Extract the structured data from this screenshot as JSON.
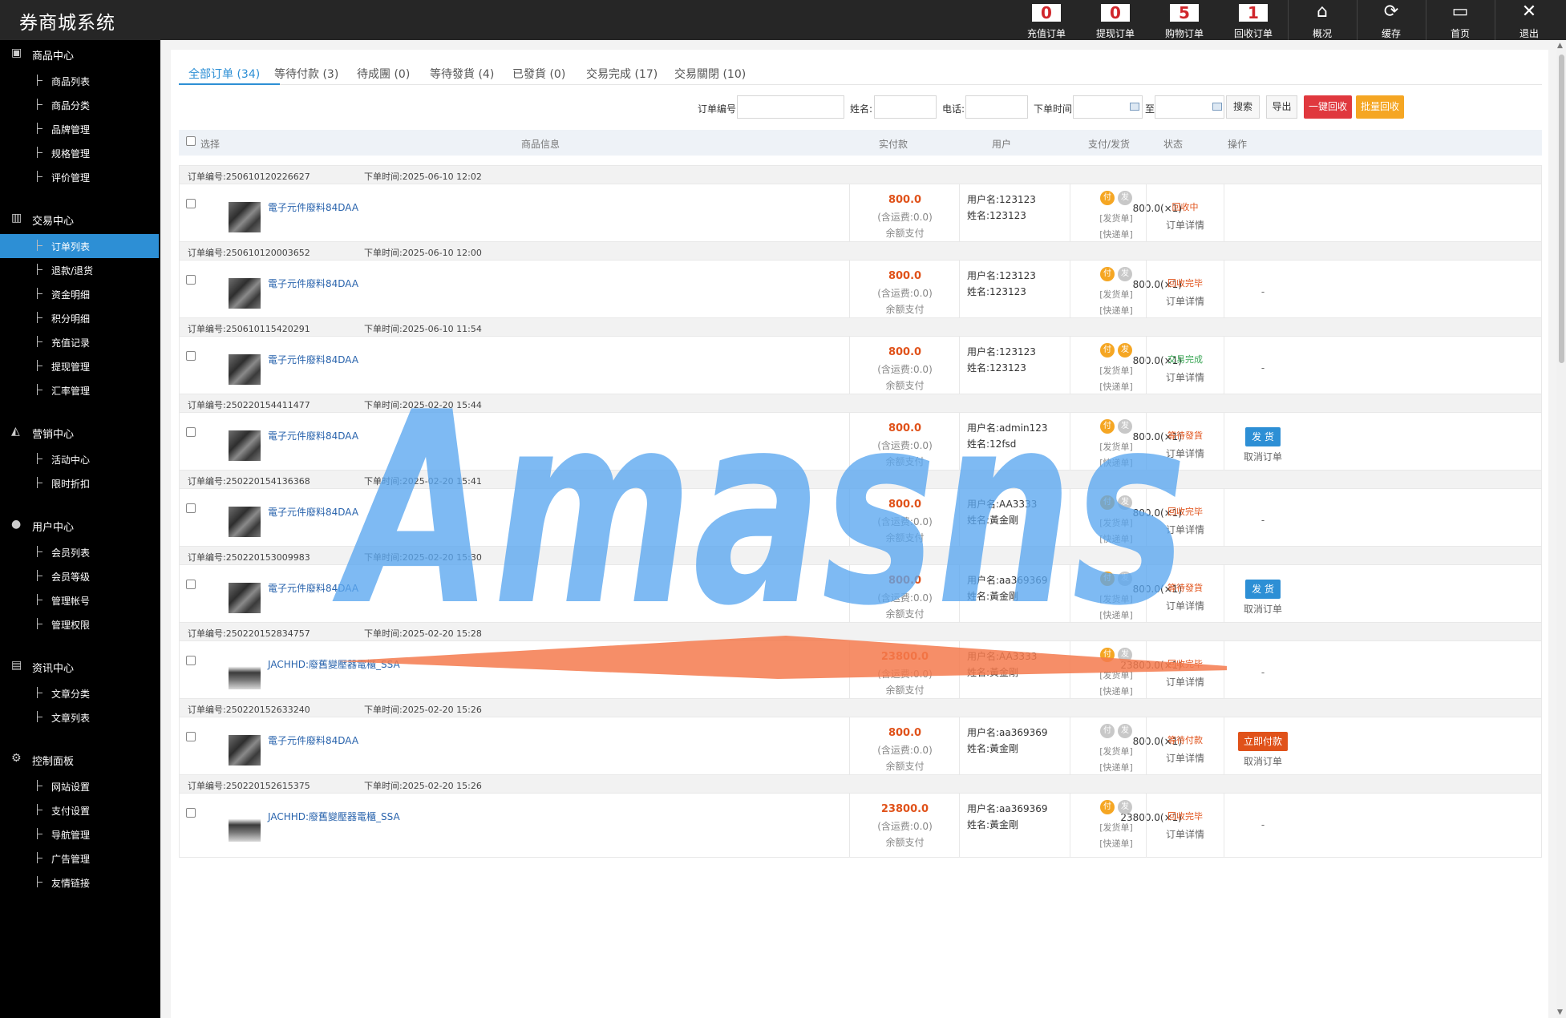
{
  "app": {
    "title": "券商城系统"
  },
  "topbar": {
    "items": [
      {
        "label": "充值订单",
        "count": "0"
      },
      {
        "label": "提现订单",
        "count": "0"
      },
      {
        "label": "购物订单",
        "count": "5"
      },
      {
        "label": "回收订单",
        "count": "1"
      },
      {
        "label": "概况",
        "icon": "home-icon"
      },
      {
        "label": "缓存",
        "icon": "refresh-icon"
      },
      {
        "label": "首页",
        "icon": "monitor-icon"
      },
      {
        "label": "退出",
        "icon": "close-icon"
      }
    ]
  },
  "sidebar": {
    "groups": [
      {
        "label": "商品中心",
        "icon": "inbox-icon",
        "items": [
          "商品列表",
          "商品分类",
          "品牌管理",
          "规格管理",
          "评价管理"
        ]
      },
      {
        "label": "交易中心",
        "icon": "bar-chart-icon",
        "items": [
          "订单列表",
          "退款/退货",
          "资金明细",
          "积分明细",
          "充值记录",
          "提现管理",
          "汇率管理"
        ]
      },
      {
        "label": "营销中心",
        "icon": "area-chart-icon",
        "items": [
          "活动中心",
          "限时折扣"
        ]
      },
      {
        "label": "用户中心",
        "icon": "user-icon",
        "items": [
          "会员列表",
          "会员等级",
          "管理帐号",
          "管理权限"
        ]
      },
      {
        "label": "资讯中心",
        "icon": "document-icon",
        "items": [
          "文章分类",
          "文章列表"
        ]
      },
      {
        "label": "控制面板",
        "icon": "gear-icon",
        "items": [
          "网站设置",
          "支付设置",
          "导航管理",
          "广告管理",
          "友情链接"
        ]
      }
    ],
    "active_item": "订单列表"
  },
  "tabs": [
    {
      "label": "全部订单  (34)",
      "active": true
    },
    {
      "label": "等待付款  (3)"
    },
    {
      "label": "待成團  (0)"
    },
    {
      "label": "等待發貨  (4)"
    },
    {
      "label": "已發貨  (0)"
    },
    {
      "label": "交易完成  (17)"
    },
    {
      "label": "交易關閉  (10)"
    }
  ],
  "filters": {
    "order_no_label": "订单编号:",
    "name_label": "姓名:",
    "phone_label": "电话:",
    "time_label": "下单时间:",
    "to_label": "至",
    "order_no_value": "",
    "name_value": "",
    "phone_value": "",
    "time_from": "",
    "time_to": "",
    "search_btn": "搜索",
    "export_btn": "导出",
    "recycle_all_btn": "一键回收",
    "batch_recycle_btn": "批量回收"
  },
  "table": {
    "headers": {
      "select": "选择",
      "product": "商品信息",
      "paid": "实付款",
      "user": "用户",
      "pay_ship": "支付/发货",
      "status": "状态",
      "action": "操作"
    },
    "order_no_prefix": "订单编号:",
    "order_time_prefix": "下单时间:",
    "shipping_prefix": "(含运费:",
    "username_prefix": "用户名:",
    "realname_prefix": "姓名:",
    "pay_badge": "付",
    "ship_badge": "发",
    "ship_link": "[发货单]",
    "express_link": "[快递单]",
    "detail_link": "订单详情",
    "orders": [
      {
        "order_no": "250610120226627",
        "time": "2025-06-10 12:02",
        "product": "電子元件廢料84DAA",
        "img": "chip",
        "price": "800.0(×1)",
        "paid": "800.0",
        "shipping": "0.0)",
        "method": "余额支付",
        "username": "123123",
        "realname": "123123",
        "paid_flag": true,
        "shipped_flag": false,
        "status": "回收中",
        "status_color": "#e0521a",
        "op": ""
      },
      {
        "order_no": "250610120003652",
        "time": "2025-06-10 12:00",
        "product": "電子元件廢料84DAA",
        "img": "chip",
        "price": "800.0(×1)",
        "paid": "800.0",
        "shipping": "0.0)",
        "method": "余额支付",
        "username": "123123",
        "realname": "123123",
        "paid_flag": true,
        "shipped_flag": false,
        "status": "回收完毕",
        "status_color": "#e0521a",
        "op": "-"
      },
      {
        "order_no": "250610115420291",
        "time": "2025-06-10 11:54",
        "product": "電子元件廢料84DAA",
        "img": "chip",
        "price": "800.0(×1)",
        "paid": "800.0",
        "shipping": "0.0)",
        "method": "余额支付",
        "username": "123123",
        "realname": "123123",
        "paid_flag": true,
        "shipped_flag": true,
        "status": "交易完成",
        "status_color": "#3aa655",
        "op": "-"
      },
      {
        "order_no": "250220154411477",
        "time": "2025-02-20 15:44",
        "product": "電子元件廢料84DAA",
        "img": "chip",
        "price": "800.0(×1)",
        "paid": "800.0",
        "shipping": "0.0)",
        "method": "余额支付",
        "username": "admin123",
        "realname": "12fsd",
        "paid_flag": true,
        "shipped_flag": false,
        "status": "等待發貨",
        "status_color": "#e0521a",
        "op": "ship",
        "op_btn": "发 货",
        "op_sub": "取消订单"
      },
      {
        "order_no": "250220154136368",
        "time": "2025-02-20 15:41",
        "product": "電子元件廢料84DAA",
        "img": "chip",
        "price": "800.0(×1)",
        "paid": "800.0",
        "shipping": "0.0)",
        "method": "余额支付",
        "username": "AA3333",
        "realname": "黃金剛",
        "paid_flag": true,
        "shipped_flag": false,
        "status": "回收完毕",
        "status_color": "#e0521a",
        "op": "-"
      },
      {
        "order_no": "250220153009983",
        "time": "2025-02-20 15:30",
        "product": "電子元件廢料84DAA",
        "img": "chip",
        "price": "800.0(×1)",
        "paid": "800.0",
        "shipping": "0.0)",
        "method": "余额支付",
        "username": "aa369369",
        "realname": "黃金剛",
        "paid_flag": true,
        "shipped_flag": false,
        "status": "等待發貨",
        "status_color": "#e0521a",
        "op": "ship",
        "op_btn": "发 货",
        "op_sub": "取消订单"
      },
      {
        "order_no": "250220152834757",
        "time": "2025-02-20 15:28",
        "product": "JACHHD:廢舊變壓器電櫃_SSA",
        "img": "bag",
        "price": "23800.0(×1)",
        "paid": "23800.0",
        "shipping": "0.0)",
        "method": "余额支付",
        "username": "AA3333",
        "realname": "黃金剛",
        "paid_flag": true,
        "shipped_flag": false,
        "status": "回收完毕",
        "status_color": "#e0521a",
        "op": "-"
      },
      {
        "order_no": "250220152633240",
        "time": "2025-02-20 15:26",
        "product": "電子元件廢料84DAA",
        "img": "chip",
        "price": "800.0(×1)",
        "paid": "800.0",
        "shipping": "0.0)",
        "method": "余额支付",
        "username": "aa369369",
        "realname": "黃金剛",
        "paid_flag": false,
        "shipped_flag": false,
        "status": "等待付款",
        "status_color": "#e0521a",
        "op": "pay",
        "op_btn": "立即付款",
        "op_sub": "取消订单"
      },
      {
        "order_no": "250220152615375",
        "time": "2025-02-20 15:26",
        "product": "JACHHD:廢舊變壓器電櫃_SSA",
        "img": "bag",
        "price": "23800.0(×1)",
        "paid": "23800.0",
        "shipping": "0.0)",
        "method": "余额支付",
        "username": "aa369369",
        "realname": "黃金剛",
        "paid_flag": true,
        "shipped_flag": false,
        "status": "回收完毕",
        "status_color": "#e0521a",
        "op": "-"
      }
    ]
  },
  "watermark": {
    "text": "Amasns",
    "color": "#5aa6ef",
    "arrow_color": "#f57a4e"
  },
  "colors": {
    "accent": "#2d8fd5",
    "danger": "#e0383e",
    "warning": "#f5a623",
    "topbar": "#262626",
    "sidebar": "#000000"
  }
}
